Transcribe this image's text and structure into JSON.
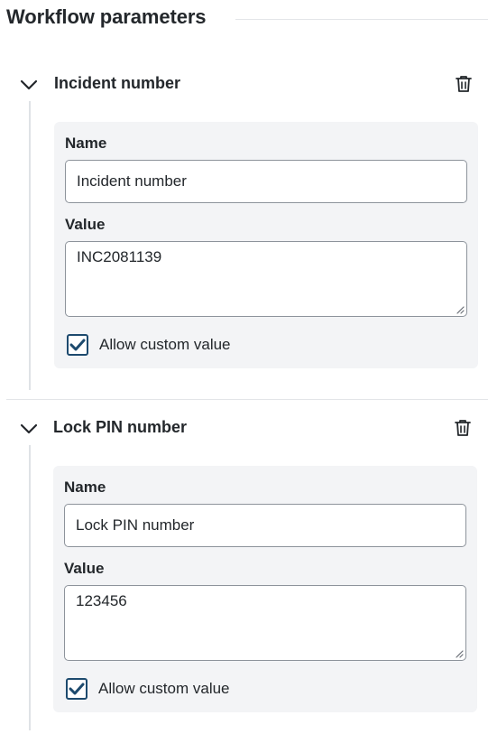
{
  "header": {
    "title": "Workflow parameters"
  },
  "params": [
    {
      "title": "Incident number",
      "name_label": "Name",
      "name_value": "Incident number",
      "value_label": "Value",
      "value_value": "INC2081139",
      "allow_custom_label": "Allow custom value",
      "allow_custom_checked": true
    },
    {
      "title": "Lock PIN number",
      "name_label": "Name",
      "name_value": "Lock PIN number",
      "value_label": "Value",
      "value_value": "123456",
      "allow_custom_label": "Allow custom value",
      "allow_custom_checked": true
    }
  ],
  "icons": {
    "collapse": "chevron-down-icon",
    "delete": "trash-icon",
    "check": "checkmark-icon"
  },
  "colors": {
    "accent": "#1d4a6e",
    "card_bg": "#f3f4f6",
    "border": "#8d939b"
  }
}
